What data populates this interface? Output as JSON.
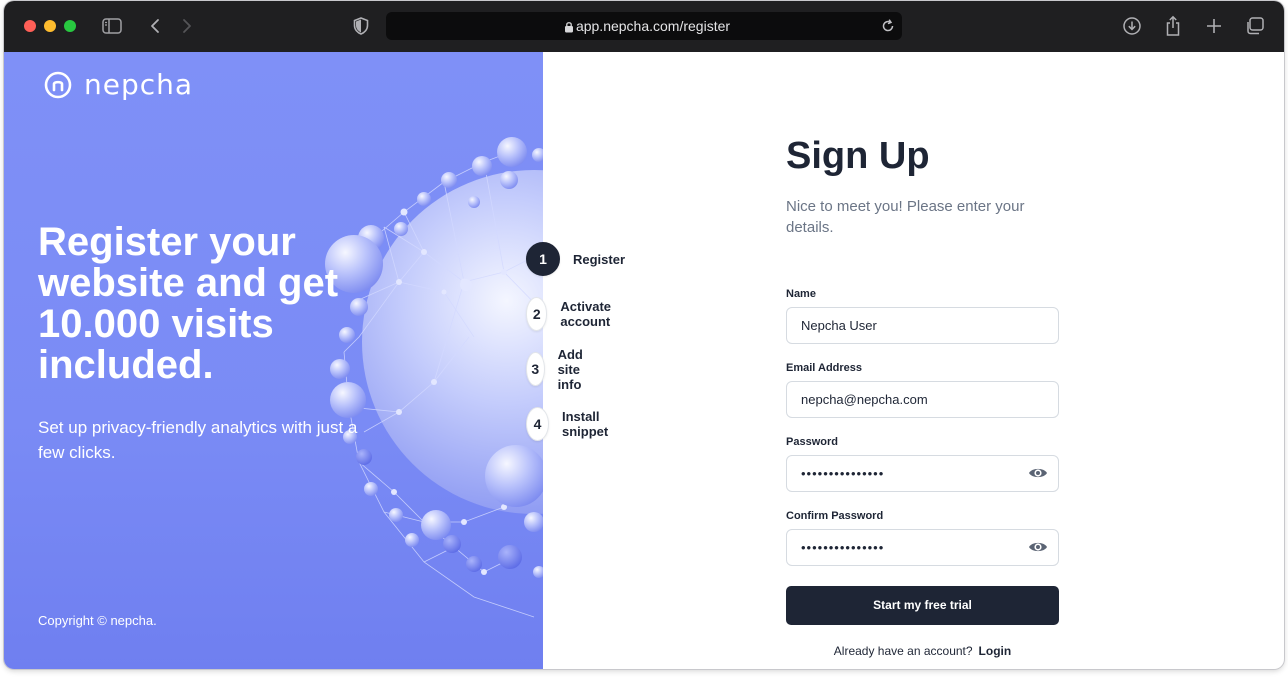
{
  "browser": {
    "url": "app.nepcha.com/register",
    "traffic_lights": [
      "#ff5f57",
      "#febc2e",
      "#28c840"
    ],
    "toolbar_icons": [
      "sidebar-icon",
      "back-icon",
      "forward-icon",
      "shield-icon",
      "download-icon",
      "share-icon",
      "new-tab-icon",
      "tabs-overview-icon"
    ]
  },
  "hero": {
    "logo_text": "nepcha",
    "title": "Register your website and get 10.000 visits included.",
    "subtitle": "Set up privacy-friendly analytics with just a few clicks.",
    "copyright": "Copyright © nepcha.",
    "gradient_color": "#7f90f7"
  },
  "steps": [
    {
      "number": "1",
      "label": "Register",
      "active": true
    },
    {
      "number": "2",
      "label": "Activate account",
      "active": false
    },
    {
      "number": "3",
      "label": "Add site info",
      "active": false
    },
    {
      "number": "4",
      "label": "Install snippet",
      "active": false
    }
  ],
  "form": {
    "title": "Sign Up",
    "subtitle": "Nice to meet you! Please enter your details.",
    "fields": {
      "name": {
        "label": "Name",
        "value": "Nepcha User"
      },
      "email": {
        "label": "Email Address",
        "value": "nepcha@nepcha.com"
      },
      "password": {
        "label": "Password",
        "value": "•••••••••••••••"
      },
      "confirm_password": {
        "label": "Confirm Password",
        "value": "•••••••••••••••"
      }
    },
    "submit_label": "Start my free trial",
    "login_prompt": "Already have an account?",
    "login_link": "Login",
    "accent_color": "#1e2535"
  }
}
